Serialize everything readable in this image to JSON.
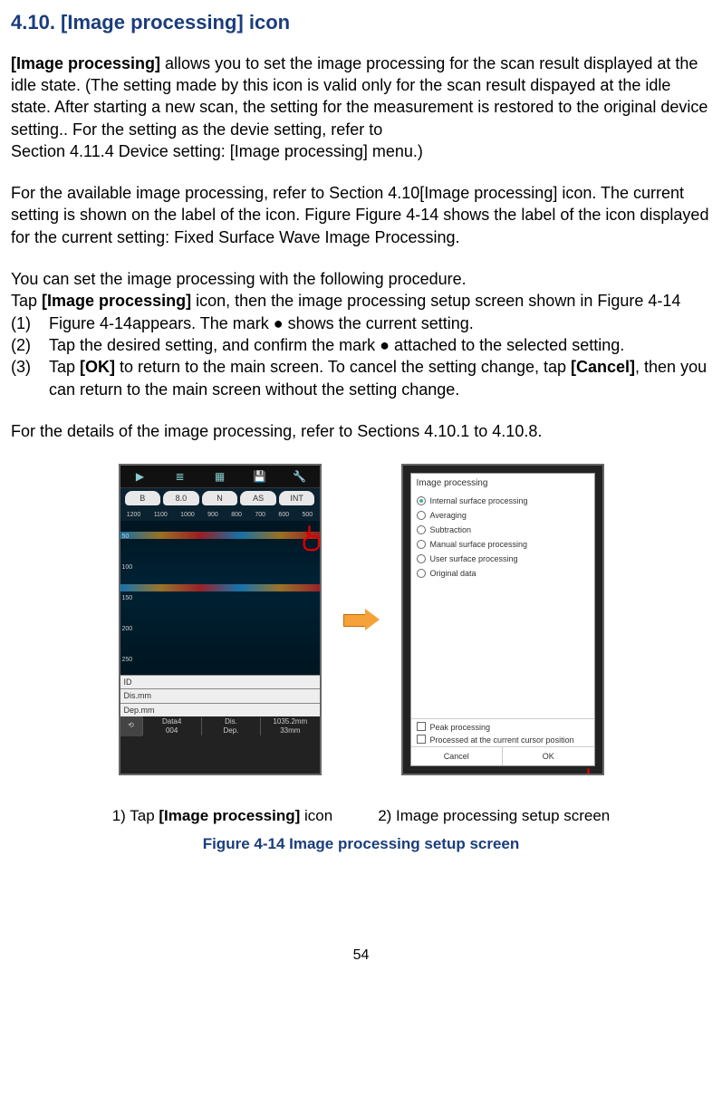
{
  "heading": "4.10.   [Image processing] icon",
  "p1_strong": "[Image processing]",
  "p1_rest": " allows you to set the image processing for the scan result displayed at the    idle state. (The setting made by this icon is valid only for the scan result dispayed at the idle state. After starting a new scan, the setting for the measurement is restored to the original device setting.. For the setting as the devie setting, refer to",
  "p1_last": "Section 4.11.4 Device setting: [Image processing] menu.)",
  "p2": "For the available image processing, refer to Section 4.10[Image processing] icon. The current setting is shown on the label of the icon. Figure Figure 4-14 shows the label of the icon displayed for the current setting: Fixed Surface Wave Image Processing.",
  "p3": "You can set the image processing with the following procedure.",
  "p3b_a": "Tap ",
  "p3b_strong": "[Image processing]",
  "p3b_b": " icon, then the image processing setup screen shown in Figure 4-14",
  "li1_num": "(1)",
  "li1": "Figure 4-14appears. The mark  ●  shows the current setting.",
  "li2_num": "(2)",
  "li2": "Tap the desired setting, and confirm the mark  ●  attached to the selected setting.",
  "li3_num": "(3)",
  "li3_a": "Tap ",
  "li3_ok": "[OK]",
  "li3_b": " to return to the main screen. To cancel the setting change, tap ",
  "li3_cancel": "[Cancel]",
  "li3_c": ", then you can return to the main screen without the setting change.",
  "p4": "For the details of the image processing, refer to Sections 4.10.1 to 4.10.8.",
  "left": {
    "tags": [
      "B",
      "8.0",
      "N",
      "AS",
      "INT"
    ],
    "ruler": [
      "1200",
      "1100",
      "1000",
      "900",
      "800",
      "700",
      "600",
      "500"
    ],
    "yaxis": [
      "50",
      "100",
      "150",
      "200",
      "250"
    ],
    "rows": [
      "ID",
      "Dis.mm",
      "Dep.mm"
    ],
    "footer": {
      "data": "Data4",
      "num": "004",
      "dis_l": "Dis.",
      "dep_l": "Dep.",
      "dis": "1035.2mm",
      "dep": "33mm"
    }
  },
  "right": {
    "title": "Image processing",
    "options": [
      "Internal surface processing",
      "Averaging",
      "Subtraction",
      "Manual surface processing",
      "User surface processing",
      "Original data"
    ],
    "checks": [
      "Peak processing",
      "Processed at the current cursor position"
    ],
    "cancel": "Cancel",
    "ok": "OK"
  },
  "cap1_a": "1) Tap ",
  "cap1_strong": "[Image processing]",
  "cap1_b": " icon",
  "cap2": "2) Image processing setup screen",
  "figtitle": "Figure 4-14 Image processing setup screen",
  "pagenum": "54"
}
